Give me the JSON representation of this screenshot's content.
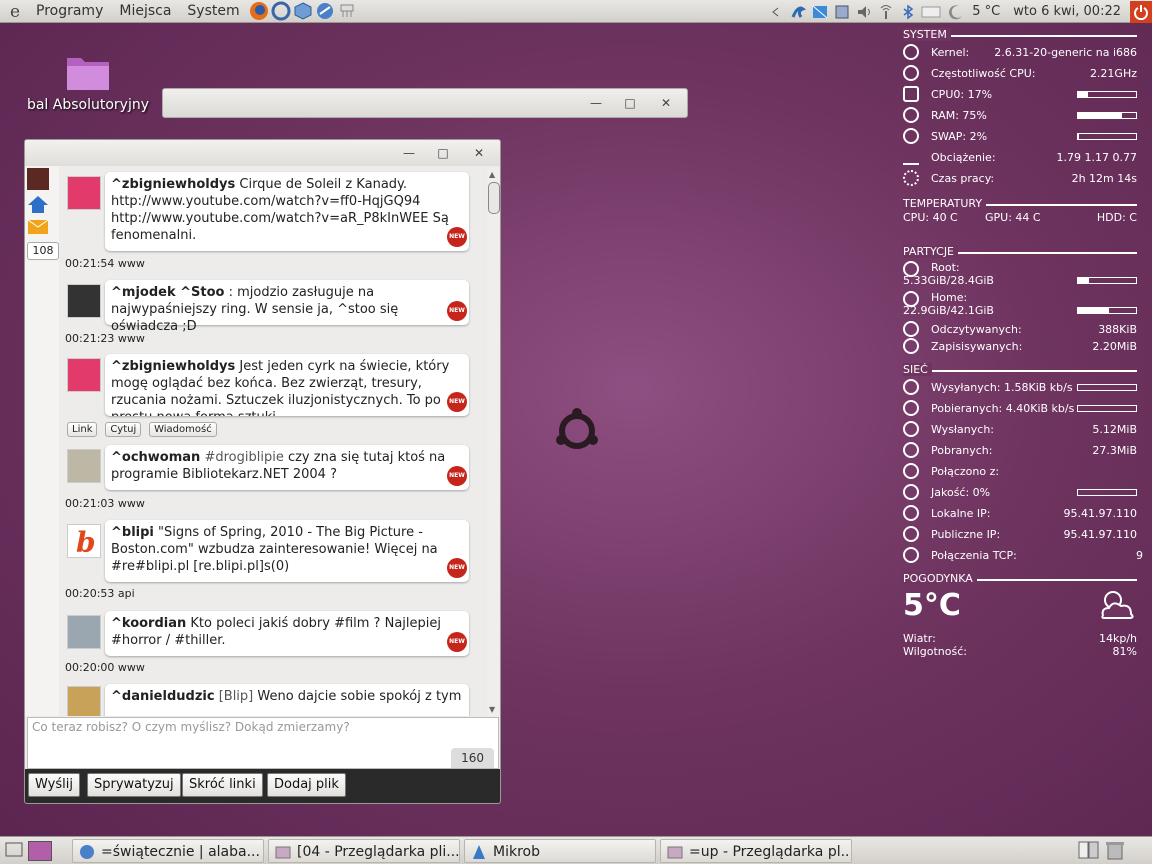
{
  "top_panel": {
    "menus": [
      "Programy",
      "Miejsca",
      "System"
    ],
    "temperature": "5 °C",
    "datetime": "wto  6 kwi, 00:22"
  },
  "desktop": {
    "icon_label": "bal Absolutoryjny"
  },
  "mikrob": {
    "sidebar_count": "108",
    "posts": [
      {
        "nick": "^zbigniewholdys",
        "text": "Cirque de Soleil z Kanady. http://www.youtube.com/watch?v=ff0-HqjGQ94 http://www.youtube.com/watch?v=aR_P8kInWEE Są fenomenalni.",
        "meta": "00:21:54 www"
      },
      {
        "nick": "^mjodek ^Stoo",
        "text": ": mjodzio zasługuje na najwypaśniejszy ring. W sensie ja, ^stoo  się oświadcza ;D",
        "meta": "00:21:23 www"
      },
      {
        "nick": "^zbigniewholdys",
        "text": "Jest jeden cyrk na świecie, który mogę oglądać bez końca. Bez zwierząt, tresury, rzucania nożami. Sztuczek iluzjonistycznych. To po prostu nowa forma sztuki",
        "meta": ""
      },
      {
        "nick": "^ochwoman",
        "tag": "#drogiblipie",
        "text": "czy zna się tutaj ktoś na programie Bibliotekarz.NET 2004 ?",
        "meta": "00:21:03 www"
      },
      {
        "nick": "^blipi",
        "text": "\"Signs of Spring, 2010 - The Big Picture - Boston.com\" wzbudza zainteresowanie! Więcej na #re#blipi.pl [re.blipi.pl]s(0)",
        "meta": "00:20:53 api"
      },
      {
        "nick": "^koordian",
        "text": "Kto poleci jakiś dobry #film ? Najlepiej #horror / #thiller.",
        "meta": "00:20:00 www"
      },
      {
        "nick": "^danieldudzic",
        "tag": "[Blip]",
        "text": "Weno dajcie sobie spokój z tym",
        "meta": ""
      }
    ],
    "action_buttons": [
      "Link",
      "Cytuj",
      "Wiadomość"
    ],
    "compose_placeholder": "Co teraz robisz? O czym myślisz? Dokąd zmierzamy?",
    "char_counter": "160",
    "bottom_buttons": [
      "Wyślij",
      "Sprywatyzuj",
      "Skróć linki",
      "Dodaj plik"
    ],
    "badge": "NEW"
  },
  "conky": {
    "system": {
      "head": "SYSTEM",
      "kernel_label": "Kernel:",
      "kernel": "2.6.31-20-generic na i686",
      "cpu_freq_label": "Częstotliwość CPU:",
      "cpu_freq": "2.21GHz",
      "cpu0_label": "CPU0: 17%",
      "cpu0_fill": 0.17,
      "ram_label": "RAM:  75%",
      "ram_fill": 0.75,
      "swap_label": "SWAP: 2%",
      "swap_fill": 0.02,
      "load_label": "Obciążenie:",
      "load": "1.79 1.17 0.77",
      "uptime_label": "Czas pracy:",
      "uptime": "2h 12m 14s"
    },
    "temps": {
      "head": "TEMPERATURY",
      "cpu": "CPU: 40 C",
      "gpu": "GPU: 44 C",
      "hdd": "HDD:  C"
    },
    "partitions": {
      "head": "PARTYCJE",
      "root_label": "Root:",
      "root": "5.33GiB/28.4GiB",
      "root_fill": 0.19,
      "home_label": "Home:",
      "home": "22.9GiB/42.1GiB",
      "home_fill": 0.54,
      "read_label": "Odczytywanych:",
      "read": "388KiB",
      "write_label": "Zapisisywanych:",
      "write": "2.20MiB"
    },
    "network": {
      "head": "SIEĆ",
      "up_label": "Wysyłanych: 1.58KiB kb/s",
      "down_label": "Pobieranych: 4.40KiB kb/s",
      "sent_label": "Wysłanych:",
      "sent": "5.12MiB",
      "recv_label": "Pobranych:",
      "recv": "27.3MiB",
      "connected_label": "Połączono z:",
      "quality_label": "Jakość: 0%",
      "quality_fill": 0,
      "local_ip_label": "Lokalne IP:",
      "local_ip": "95.41.97.110",
      "public_ip_label": "Publiczne IP:",
      "public_ip": "95.41.97.110",
      "tcp_label": "Połączenia TCP:",
      "tcp": "9"
    },
    "weather": {
      "head": "POGODYNKA",
      "temp": "5°C",
      "wind_label": "Wiatr:",
      "wind": "14kp/h",
      "humidity_label": "Wilgotność:",
      "humidity": "81%"
    }
  },
  "taskbar": {
    "tasks": [
      "=świątecznie | alaba...",
      "[04 - Przeglądarka pli...",
      "Mikrob",
      "=up - Przeglądarka pl..."
    ]
  }
}
